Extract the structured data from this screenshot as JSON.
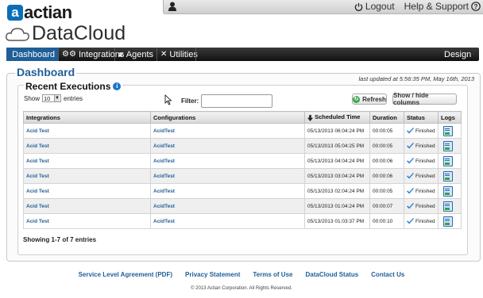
{
  "brand": {
    "logo_text": "actian",
    "product": "DataCloud"
  },
  "topbar": {
    "logout": "Logout",
    "help": "Help & Support"
  },
  "nav": {
    "dashboard": "Dashboard",
    "integrations": "Integrations",
    "agents": "Agents",
    "utilities": "Utilities",
    "design": "Design"
  },
  "page": {
    "title": "Dashboard",
    "last_updated": "last updated at 5:56:35 PM, May 16th, 2013"
  },
  "executions": {
    "title": "Recent Executions",
    "show_label": "Show",
    "page_size": "10",
    "entries_label": "entries",
    "filter_label": "Filter:",
    "filter_value": "",
    "refresh": "Refresh",
    "show_hide": "Show / hide columns",
    "columns": [
      "Integrations",
      "Configurations",
      "Scheduled Time",
      "Duration",
      "Status",
      "Logs"
    ],
    "rows": [
      {
        "integration": "Acid Test",
        "configuration": "AcidTest",
        "time": "05/13/2013 06:04:24 PM",
        "duration": "00:00:05",
        "status": "Finished"
      },
      {
        "integration": "Acid Test",
        "configuration": "AcidTest",
        "time": "05/13/2013 05:04:25 PM",
        "duration": "00:00:05",
        "status": "Finished"
      },
      {
        "integration": "Acid Test",
        "configuration": "AcidTest",
        "time": "05/13/2013 04:04:24 PM",
        "duration": "00:00:06",
        "status": "Finished"
      },
      {
        "integration": "Acid Test",
        "configuration": "AcidTest",
        "time": "05/13/2013 03:04:24 PM",
        "duration": "00:00:06",
        "status": "Finished"
      },
      {
        "integration": "Acid Test",
        "configuration": "AcidTest",
        "time": "05/13/2013 02:04:24 PM",
        "duration": "00:00:05",
        "status": "Finished"
      },
      {
        "integration": "Acid Test",
        "configuration": "AcidTest",
        "time": "05/13/2013 01:04:24 PM",
        "duration": "00:00:07",
        "status": "Finished"
      },
      {
        "integration": "Acid Test",
        "configuration": "AcidTest",
        "time": "05/13/2013 01:03:37 PM",
        "duration": "00:00:10",
        "status": "Finished"
      }
    ],
    "showing": "Showing 1-7 of 7 entries"
  },
  "footer": {
    "links": [
      "Service Level Agreement (PDF)",
      "Privacy Statement",
      "Terms of Use",
      "DataCloud Status",
      "Contact Us"
    ],
    "copyright": "© 2013 Actian Corporation. All Rights Reserved."
  },
  "colors": {
    "accent": "#1f5f97",
    "brand": "#0a6fb6",
    "status_ok": "#35a341"
  }
}
